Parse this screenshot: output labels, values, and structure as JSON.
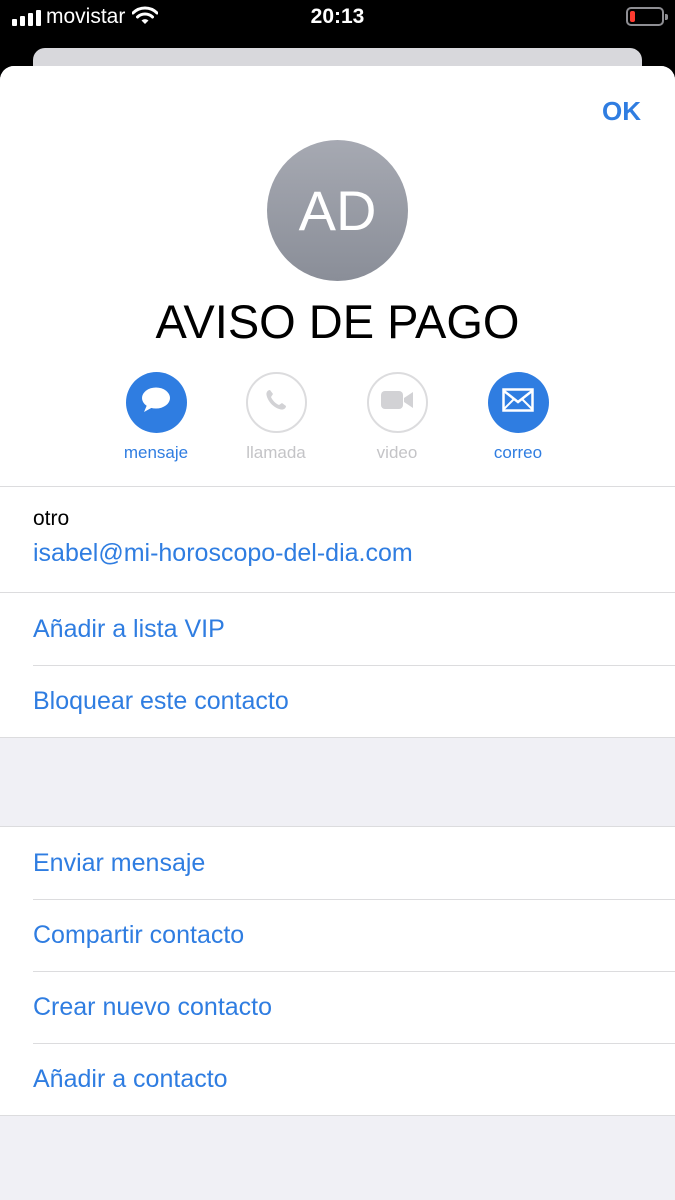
{
  "status_bar": {
    "carrier": "movistar",
    "time": "20:13"
  },
  "header": {
    "done_label": "OK",
    "avatar_initials": "AD",
    "contact_name": "AVISO DE PAGO"
  },
  "actions": [
    {
      "label": "mensaje",
      "icon": "message-bubble-icon",
      "enabled": true
    },
    {
      "label": "llamada",
      "icon": "phone-icon",
      "enabled": false
    },
    {
      "label": "video",
      "icon": "video-camera-icon",
      "enabled": false
    },
    {
      "label": "correo",
      "icon": "envelope-icon",
      "enabled": true
    }
  ],
  "email": {
    "type": "otro",
    "address": "isabel@mi-horoscopo-del-dia.com"
  },
  "options_group_1": [
    {
      "label": "Añadir a lista VIP"
    },
    {
      "label": "Bloquear este contacto"
    }
  ],
  "options_group_2": [
    {
      "label": "Enviar mensaje"
    },
    {
      "label": "Compartir contacto"
    },
    {
      "label": "Crear nuevo contacto"
    },
    {
      "label": "Añadir a contacto"
    }
  ],
  "colors": {
    "accent": "#2f7de1",
    "disabled": "#c4c4c7",
    "background": "#f0f0f5",
    "battery_low": "#ff3b30"
  }
}
